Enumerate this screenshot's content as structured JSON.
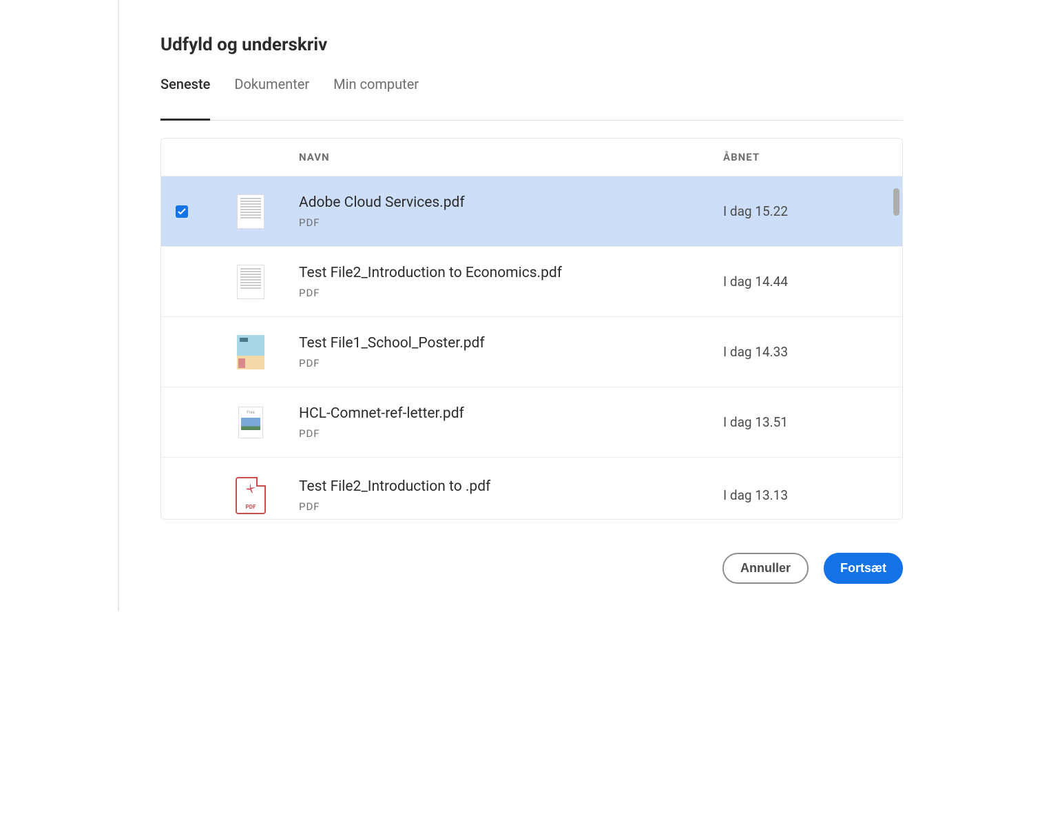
{
  "dialog": {
    "title": "Udfyld og underskriv"
  },
  "tabs": {
    "items": [
      {
        "label": "Seneste",
        "active": true
      },
      {
        "label": "Dokumenter",
        "active": false
      },
      {
        "label": "Min computer",
        "active": false
      }
    ]
  },
  "table": {
    "headers": {
      "name": "NAVN",
      "opened": "ÅBNET"
    },
    "rows": [
      {
        "selected": true,
        "thumb": "doc",
        "name": "Adobe Cloud Services.pdf",
        "type": "PDF",
        "opened": "I dag 15.22"
      },
      {
        "selected": false,
        "thumb": "doc",
        "name": "Test File2_Introduction to Economics.pdf",
        "type": "PDF",
        "opened": "I dag 14.44"
      },
      {
        "selected": false,
        "thumb": "poster",
        "name": "Test File1_School_Poster.pdf",
        "type": "PDF",
        "opened": "I dag 14.33"
      },
      {
        "selected": false,
        "thumb": "photo",
        "name": "HCL-Comnet-ref-letter.pdf",
        "type": "PDF",
        "opened": "I dag 13.51"
      },
      {
        "selected": false,
        "thumb": "pdficon",
        "name": "Test File2_Introduction to .pdf",
        "type": "PDF",
        "opened": "I dag 13.13"
      }
    ]
  },
  "footer": {
    "cancel": "Annuller",
    "continue": "Fortsæt"
  }
}
